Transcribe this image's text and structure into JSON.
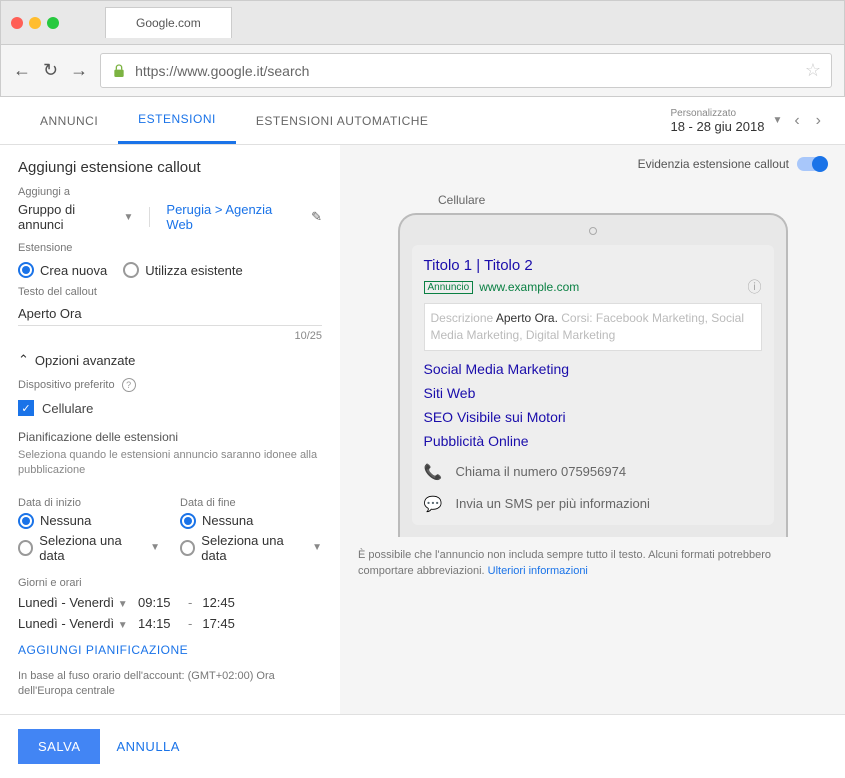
{
  "browser": {
    "tab_title": "Google.com",
    "url": "https://www.google.it/search"
  },
  "top_tabs": {
    "tab1": "ANNUNCI",
    "tab2": "ESTENSIONI",
    "tab3": "ESTENSIONI AUTOMATICHE"
  },
  "date_range": {
    "label": "Personalizzato",
    "value": "18 - 28 giu 2018"
  },
  "left": {
    "title": "Aggiungi estensione callout",
    "add_to_label": "Aggiungi a",
    "add_to_value": "Gruppo di annunci",
    "breadcrumb": "Perugia > Agenzia Web",
    "extension_label": "Estensione",
    "create_new": "Crea nuova",
    "use_existing": "Utilizza esistente",
    "callout_text_label": "Testo del callout",
    "callout_text_value": "Aperto Ora",
    "char_count": "10/25",
    "advanced": "Opzioni avanzate",
    "preferred_device": "Dispositivo preferito",
    "mobile": "Cellulare",
    "scheduling_title": "Pianificazione delle estensioni",
    "scheduling_desc": "Seleziona quando le estensioni annuncio saranno idonee alla pubblicazione",
    "start_date_label": "Data di inizio",
    "end_date_label": "Data di fine",
    "none": "Nessuna",
    "select_date": "Seleziona una data",
    "days_hours": "Giorni e orari",
    "schedule": [
      {
        "days": "Lunedì - Venerdì",
        "start": "09:15",
        "end": "12:45"
      },
      {
        "days": "Lunedì - Venerdì",
        "start": "14:15",
        "end": "17:45"
      }
    ],
    "add_schedule": "AGGIUNGI PIANIFICAZIONE",
    "tz_note": "In base al fuso orario dell'account: (GMT+02:00) Ora dell'Europa centrale"
  },
  "footer": {
    "save": "SALVA",
    "cancel": "ANNULLA"
  },
  "right": {
    "highlight_label": "Evidenzia estensione callout",
    "preview_device": "Cellulare",
    "ad": {
      "title": "Titolo 1 | Titolo 2",
      "badge": "Annuncio",
      "url": "www.example.com",
      "desc_prefix": "Descrizione ",
      "desc_highlight": "Aperto Ora.",
      "desc_suffix": " Corsi: Facebook Marketing, Social Media Marketing, Digital Marketing",
      "links": [
        "Social Media Marketing",
        "Siti Web",
        "SEO Visibile sui Motori",
        "Pubblicità Online"
      ],
      "call": "Chiama il numero 075956974",
      "sms": "Invia un SMS per più informazioni"
    },
    "note_text": "È possibile che l'annuncio non includa sempre tutto il testo. Alcuni formati potrebbero comportare abbreviazioni. ",
    "note_link": "Ulteriori informazioni"
  }
}
